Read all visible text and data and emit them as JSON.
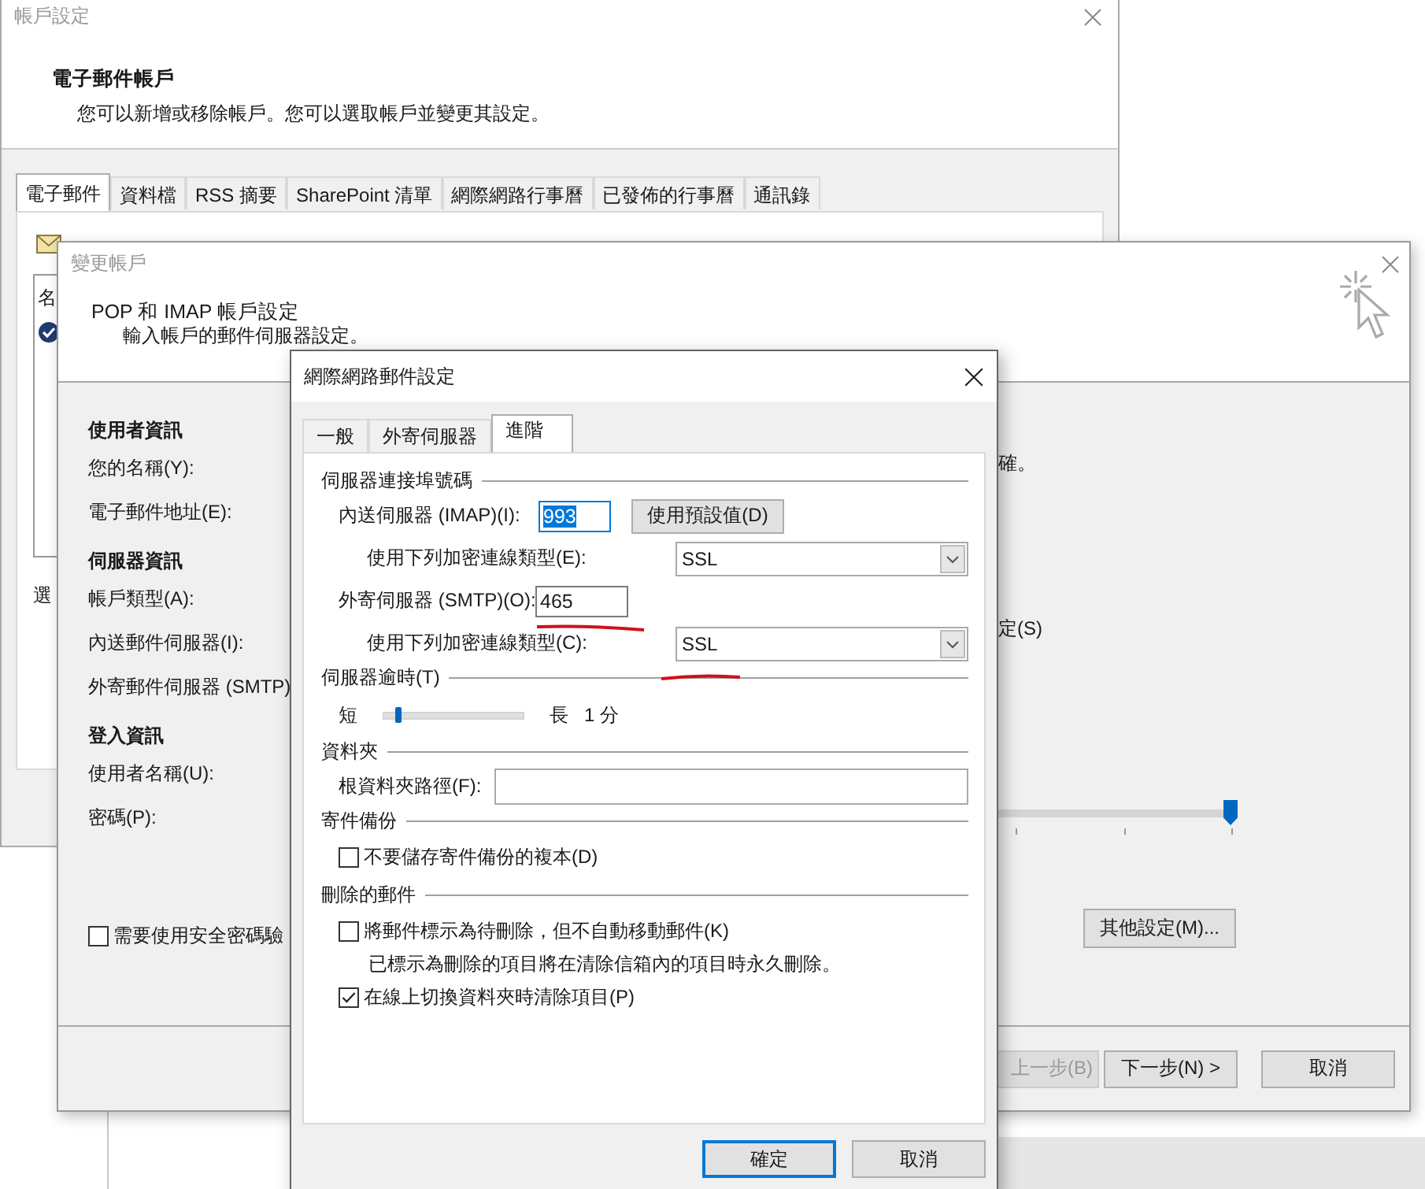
{
  "account_settings": {
    "title": "帳戶設定",
    "heading": "電子郵件帳戶",
    "description": "您可以新增或移除帳戶。您可以選取帳戶並變更其設定。",
    "tabs": [
      {
        "label": "電子郵件",
        "selected": true
      },
      {
        "label": "資料檔",
        "selected": false
      },
      {
        "label": "RSS 摘要",
        "selected": false
      },
      {
        "label": "SharePoint 清單",
        "selected": false
      },
      {
        "label": "網際網路行事曆",
        "selected": false
      },
      {
        "label": "已發佈的行事曆",
        "selected": false
      },
      {
        "label": "通訊錄",
        "selected": false
      }
    ],
    "list_header": "名",
    "label_fragment": "選"
  },
  "change_account": {
    "title": "變更帳戶",
    "heading": "POP 和 IMAP 帳戶設定",
    "description": "輸入帳戶的郵件伺服器設定。",
    "sections": [
      {
        "heading": "使用者資訊",
        "fields": [
          "您的名稱(Y):",
          "電子郵件地址(E):"
        ]
      },
      {
        "heading": "伺服器資訊",
        "fields": [
          "帳戶類型(A):",
          "內送郵件伺服器(I):",
          "外寄郵件伺服器 (SMTP)"
        ]
      },
      {
        "heading": "登入資訊",
        "fields": [
          "使用者名稱(U):",
          "密碼(P):"
        ]
      }
    ],
    "spa_checkbox": {
      "label": "需要使用安全密碼驗",
      "checked": false
    },
    "text_fragments": [
      "確。",
      "定(S)"
    ],
    "slider": {
      "level": 1
    },
    "more_settings_button": "其他設定(M)...",
    "buttons": [
      {
        "label": "上一步(B)",
        "disabled": true
      },
      {
        "label": "下一步(N) >",
        "disabled": false
      },
      {
        "label": "取消",
        "disabled": false
      }
    ]
  },
  "internet_email_settings": {
    "title": "網際網路郵件設定",
    "tabs": [
      {
        "label": "一般",
        "selected": false
      },
      {
        "label": "外寄伺服器",
        "selected": false
      },
      {
        "label": "進階",
        "selected": true
      }
    ],
    "server_ports": {
      "heading": "伺服器連接埠號碼",
      "incoming_label": "內送伺服器 (IMAP)(I):",
      "incoming_port": "993",
      "incoming_port_highlighted": true,
      "default_button": "使用預設值(D)",
      "incoming_encryption_label": "使用下列加密連線類型(E):",
      "incoming_encryption": "SSL",
      "outgoing_label": "外寄伺服器 (SMTP)(O):",
      "outgoing_port": "465",
      "outgoing_encryption_label": "使用下列加密連線類型(C):",
      "outgoing_encryption": "SSL"
    },
    "timeout": {
      "heading": "伺服器逾時(T)",
      "short_label": "短",
      "long_label": "長",
      "level": 0.1,
      "value": "1 分"
    },
    "folders": {
      "heading": "資料夾",
      "root_label": "根資料夾路徑(F):"
    },
    "sent_items": {
      "heading": "寄件備份",
      "options": [
        {
          "kind": "checkbox",
          "label": "不要儲存寄件備份的複本(D)",
          "checked": false
        }
      ]
    },
    "deleted_items": {
      "heading": "刪除的郵件",
      "options": [
        {
          "kind": "checkbox",
          "label": "將郵件標示為待刪除，但不自動移動郵件(K)",
          "checked": false
        },
        {
          "kind": "note",
          "label": "已標示為刪除的項目將在清除信箱內的項目時永久刪除。"
        },
        {
          "kind": "checkbox",
          "label": "在線上切換資料夾時清除項目(P)",
          "checked": true
        }
      ]
    },
    "buttons": [
      {
        "label": "確定",
        "default": true
      },
      {
        "label": "取消",
        "default": false
      }
    ]
  }
}
